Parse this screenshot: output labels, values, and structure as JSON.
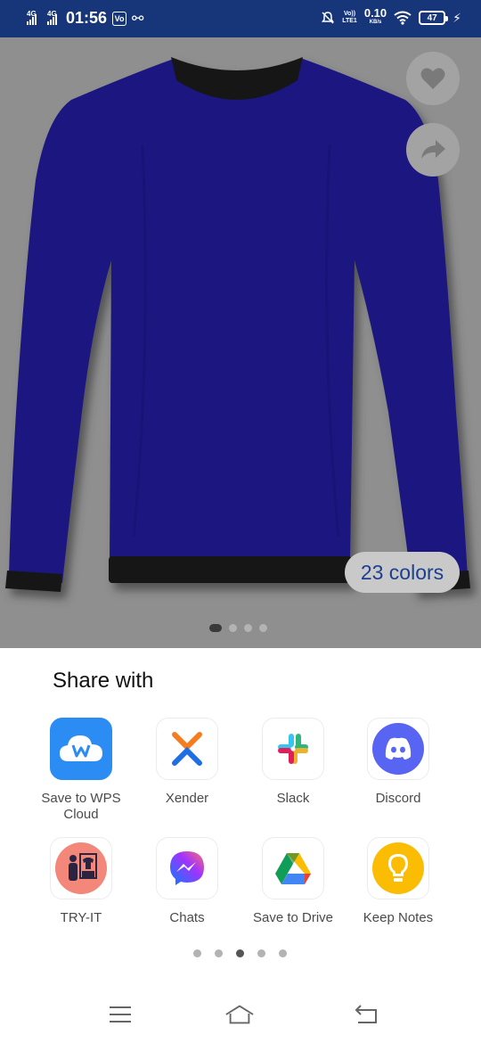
{
  "status_bar": {
    "network1": "4G",
    "network2": "4G",
    "time": "01:56",
    "notif_badge": "Vo",
    "volte_top": "Vo))",
    "volte_bottom": "LTE1",
    "speed_value": "0.10",
    "speed_unit": "KB/s",
    "battery": "47"
  },
  "product": {
    "shirt_color": "#1b1480",
    "trim_color": "#151515",
    "colors_badge": "23 colors",
    "image_count": 4,
    "current_image_index": 0,
    "icons": [
      "heart-icon",
      "share-arrow-icon"
    ]
  },
  "share_sheet": {
    "title": "Share with",
    "apps": [
      {
        "label": "Save to WPS Cloud",
        "icon": "wps-cloud-icon",
        "line1": "Save to WPS",
        "line2": "Cloud"
      },
      {
        "label": "Xender",
        "icon": "xender-icon"
      },
      {
        "label": "Slack",
        "icon": "slack-icon"
      },
      {
        "label": "Discord",
        "icon": "discord-icon"
      },
      {
        "label": "TRY-IT",
        "icon": "try-it-icon"
      },
      {
        "label": "Chats",
        "icon": "messenger-icon"
      },
      {
        "label": "Save to Drive",
        "icon": "google-drive-icon"
      },
      {
        "label": "Keep Notes",
        "icon": "keep-notes-icon"
      }
    ],
    "page_count": 5,
    "current_page": 3
  },
  "nav_bar": {
    "icons": [
      "menu-icon",
      "home-icon",
      "back-icon"
    ]
  }
}
